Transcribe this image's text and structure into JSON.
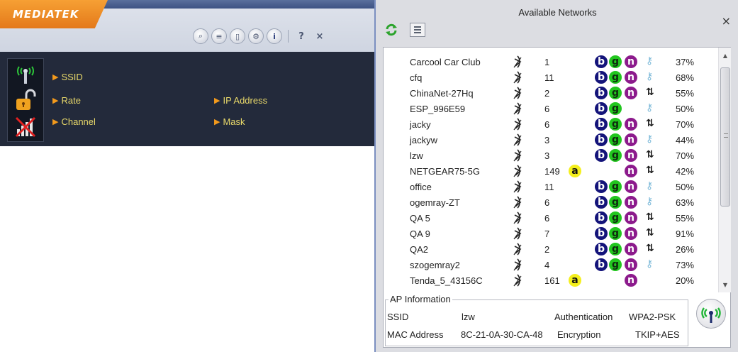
{
  "brand": {
    "name": "MEDIATEK",
    "color": "#f39a1c"
  },
  "toolbar": {
    "icons": [
      "search-icon",
      "list-icon",
      "copy-icon",
      "settings-icon",
      "info-icon"
    ],
    "help_label": "?",
    "close_label": "×"
  },
  "status_icons": [
    "signal-tower-icon",
    "unlocked-padlock-icon",
    "disconnected-icon"
  ],
  "link_info": {
    "ssid_label": "SSID",
    "rate_label": "Rate",
    "channel_label": "Channel",
    "ip_label": "IP Address",
    "mask_label": "Mask"
  },
  "networks_window": {
    "title": "Available Networks",
    "close_label": "×",
    "refresh_icon": "refresh-icon",
    "list_icon": "list-view-icon"
  },
  "networks": [
    {
      "ssid": "Carcool Car Club",
      "channel": "1",
      "a": false,
      "b": true,
      "g": true,
      "n": true,
      "security": "key",
      "strength": "37%"
    },
    {
      "ssid": "cfq",
      "channel": "11",
      "a": false,
      "b": true,
      "g": true,
      "n": true,
      "security": "key",
      "strength": "68%"
    },
    {
      "ssid": "ChinaNet-27Hq",
      "channel": "2",
      "a": false,
      "b": true,
      "g": true,
      "n": true,
      "security": "open",
      "strength": "55%"
    },
    {
      "ssid": "ESP_996E59",
      "channel": "6",
      "a": false,
      "b": true,
      "g": true,
      "n": false,
      "security": "key",
      "strength": "50%"
    },
    {
      "ssid": "jacky",
      "channel": "6",
      "a": false,
      "b": true,
      "g": true,
      "n": true,
      "security": "open",
      "strength": "70%"
    },
    {
      "ssid": "jackyw",
      "channel": "3",
      "a": false,
      "b": true,
      "g": true,
      "n": true,
      "security": "key",
      "strength": "44%"
    },
    {
      "ssid": "lzw",
      "channel": "3",
      "a": false,
      "b": true,
      "g": true,
      "n": true,
      "security": "open",
      "strength": "70%"
    },
    {
      "ssid": "NETGEAR75-5G",
      "channel": "149",
      "a": true,
      "b": false,
      "g": false,
      "n": true,
      "security": "open",
      "strength": "42%"
    },
    {
      "ssid": "office",
      "channel": "11",
      "a": false,
      "b": true,
      "g": true,
      "n": true,
      "security": "key",
      "strength": "50%"
    },
    {
      "ssid": "ogemray-ZT",
      "channel": "6",
      "a": false,
      "b": true,
      "g": true,
      "n": true,
      "security": "key",
      "strength": "63%"
    },
    {
      "ssid": "QA 5",
      "channel": "6",
      "a": false,
      "b": true,
      "g": true,
      "n": true,
      "security": "open",
      "strength": "55%"
    },
    {
      "ssid": "QA 9",
      "channel": "7",
      "a": false,
      "b": true,
      "g": true,
      "n": true,
      "security": "open",
      "strength": "91%"
    },
    {
      "ssid": "QA2",
      "channel": "2",
      "a": false,
      "b": true,
      "g": true,
      "n": true,
      "security": "open",
      "strength": "26%"
    },
    {
      "ssid": "szogemray2",
      "channel": "4",
      "a": false,
      "b": true,
      "g": true,
      "n": true,
      "security": "key",
      "strength": "73%"
    },
    {
      "ssid": "Tenda_5_43156C",
      "channel": "161",
      "a": true,
      "b": false,
      "g": false,
      "n": true,
      "security": "none",
      "strength": "20%"
    }
  ],
  "badges": {
    "a": "a",
    "b": "b",
    "g": "g",
    "n": "n"
  },
  "ap_info": {
    "legend": "AP Information",
    "ssid_label": "SSID",
    "ssid_value": "lzw",
    "auth_label": "Authentication",
    "auth_value": "WPA2-PSK",
    "mac_label": "MAC Address",
    "mac_value": "8C-21-0A-30-CA-48",
    "enc_label": "Encryption",
    "enc_value": "TKIP+AES",
    "icon": "signal-tower-icon"
  },
  "scrollbar": {
    "position": 0.0
  },
  "colors": {
    "panel_dark": "#232a3b",
    "field_text": "#e9d96a",
    "badge_a": "#f4ef1c",
    "badge_b": "#14147a",
    "badge_g": "#22c61f",
    "badge_n": "#8c1a8c"
  }
}
